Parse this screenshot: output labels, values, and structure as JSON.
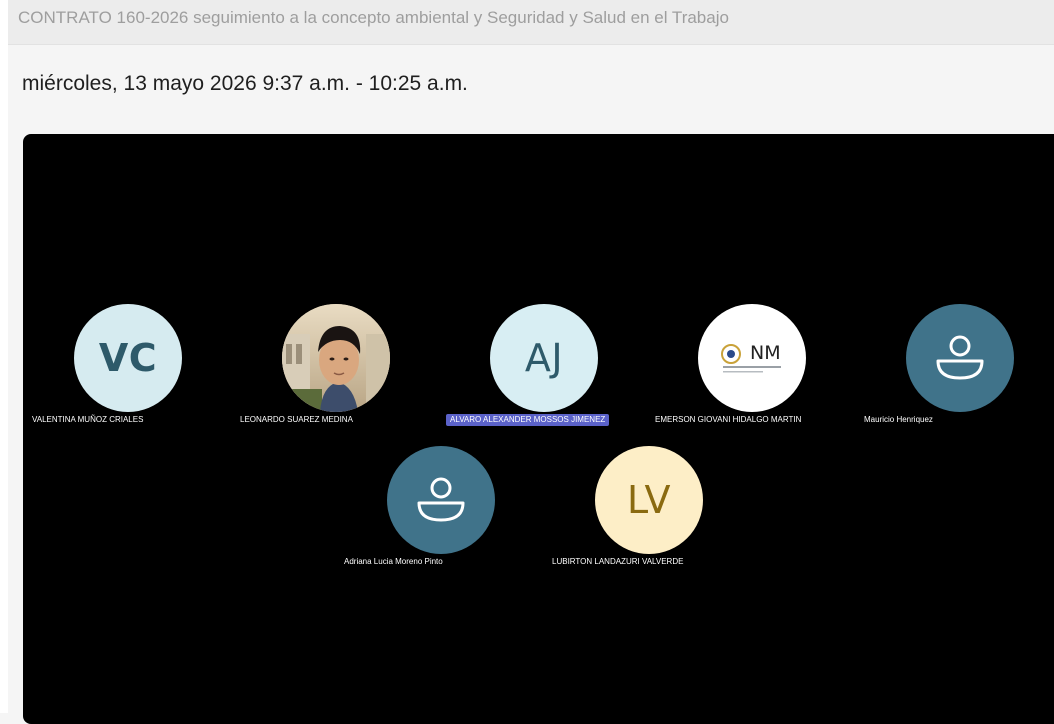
{
  "window": {
    "title": "CONTRATO 160-2026 seguimiento a la concepto ambiental y Seguridad y Salud en el Trabajo"
  },
  "meeting": {
    "datetime": "miércoles, 13 mayo 2026 9:37 a.m. - 10:25 a.m."
  },
  "participants": [
    {
      "name": "VALENTINA MUÑOZ CRIALES",
      "initials": "VC",
      "avatar": "initials",
      "color": "#d6ebf0"
    },
    {
      "name": "LEONARDO SUAREZ MEDINA",
      "initials": "",
      "avatar": "photo"
    },
    {
      "name": "ALVARO ALEXANDER MOSSOS JIMENEZ",
      "initials": "AJ",
      "avatar": "initials",
      "color": "#d8eef3",
      "highlighted": true
    },
    {
      "name": "EMERSON GIOVANI HIDALGO MARTIN",
      "initials": "",
      "avatar": "logo",
      "logo_text": "NM"
    },
    {
      "name": "Mauricio Henriquez",
      "initials": "",
      "avatar": "person-icon",
      "color": "#40738a"
    },
    {
      "name": "Adriana Lucia Moreno Pinto",
      "initials": "",
      "avatar": "person-icon",
      "color": "#40738a"
    },
    {
      "name": "LUBIRTON LANDAZURI VALVERDE",
      "initials": "LV",
      "avatar": "initials",
      "color": "#fdeec7"
    }
  ]
}
